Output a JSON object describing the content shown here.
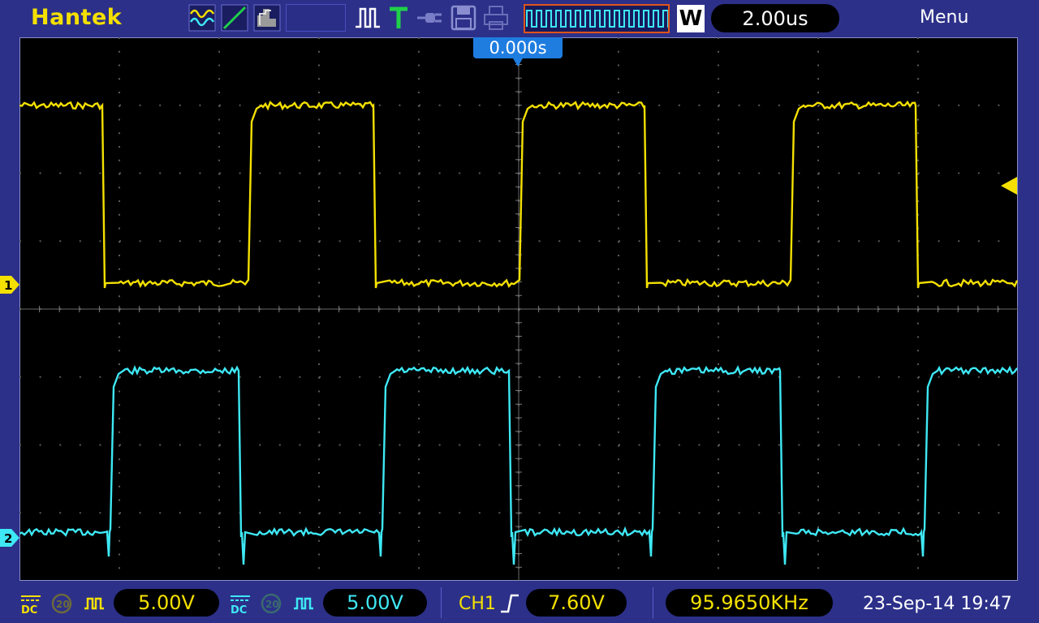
{
  "brand": "Hantek",
  "timebase": "2.00us",
  "menu_label": "Menu",
  "trigger_label": "W",
  "trigger_position": "0.000s",
  "colors": {
    "ch1": "#f4e000",
    "ch2": "#3ee8f4",
    "background": "#2c3089",
    "screen": "#000000",
    "accent": "#1f7de0"
  },
  "channels": [
    {
      "id": "1",
      "coupling": "DC",
      "volts_per_div": "5.00V",
      "color": "#f4e000"
    },
    {
      "id": "2",
      "coupling": "DC",
      "volts_per_div": "5.00V",
      "color": "#3ee8f4"
    }
  ],
  "trigger": {
    "source": "CH1",
    "edge": "rising",
    "level": "7.60V"
  },
  "frequency": "95.9650KHz",
  "datetime": "23-Sep-14 19:47",
  "icons": [
    "wave-mode-icon",
    "line-mode-icon",
    "persist-icon",
    "pulse-icon",
    "trigger-t-icon",
    "probe-icon",
    "save-icon",
    "print-icon"
  ]
}
